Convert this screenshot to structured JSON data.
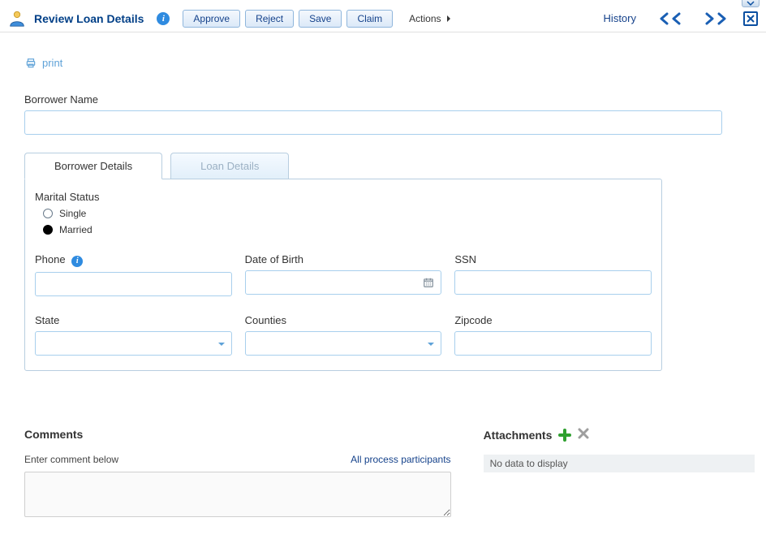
{
  "pulldown_tip": "Expand",
  "header": {
    "title": "Review Loan Details",
    "info_tip": "Info",
    "approve_label": "Approve",
    "reject_label": "Reject",
    "save_label": "Save",
    "claim_label": "Claim",
    "actions_label": "Actions",
    "history_label": "History"
  },
  "print_label": "print",
  "form": {
    "borrower_name_label": "Borrower Name",
    "borrower_name_value": "",
    "tabs": {
      "borrower_details": "Borrower Details",
      "loan_details": "Loan Details"
    },
    "marital_status_label": "Marital Status",
    "marital_options": {
      "single": "Single",
      "married": "Married"
    },
    "marital_selected": "married",
    "phone_label": "Phone",
    "phone_value": "",
    "dob_label": "Date of Birth",
    "dob_value": "",
    "ssn_label": "SSN",
    "ssn_value": "",
    "state_label": "State",
    "state_value": "",
    "counties_label": "Counties",
    "counties_value": "",
    "zipcode_label": "Zipcode",
    "zipcode_value": ""
  },
  "comments": {
    "title": "Comments",
    "enter_label": "Enter comment below",
    "participants_label": "All process participants",
    "value": ""
  },
  "attachments": {
    "title": "Attachments",
    "empty_text": "No data to display"
  }
}
